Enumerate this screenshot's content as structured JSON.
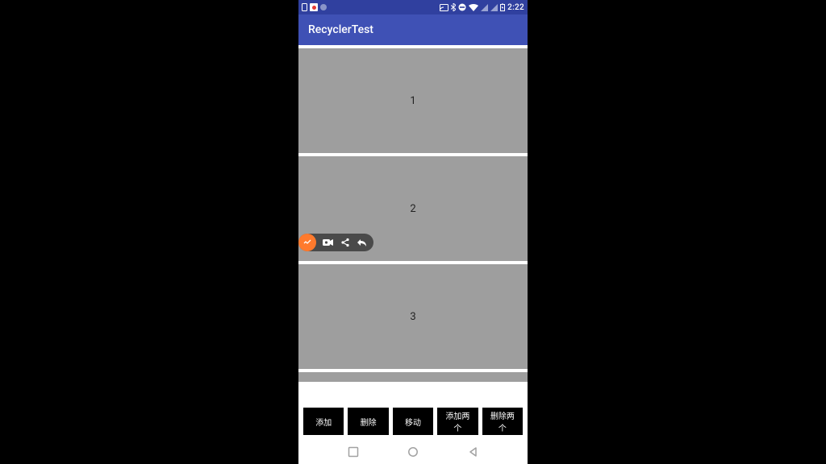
{
  "status": {
    "time": "2:22"
  },
  "appbar": {
    "title": "RecyclerTest"
  },
  "list": {
    "items": [
      "1",
      "2",
      "3"
    ]
  },
  "buttons": {
    "add": "添加",
    "remove": "删除",
    "move": "移动",
    "add_two": "添加两个",
    "remove_two": "删除两个"
  }
}
